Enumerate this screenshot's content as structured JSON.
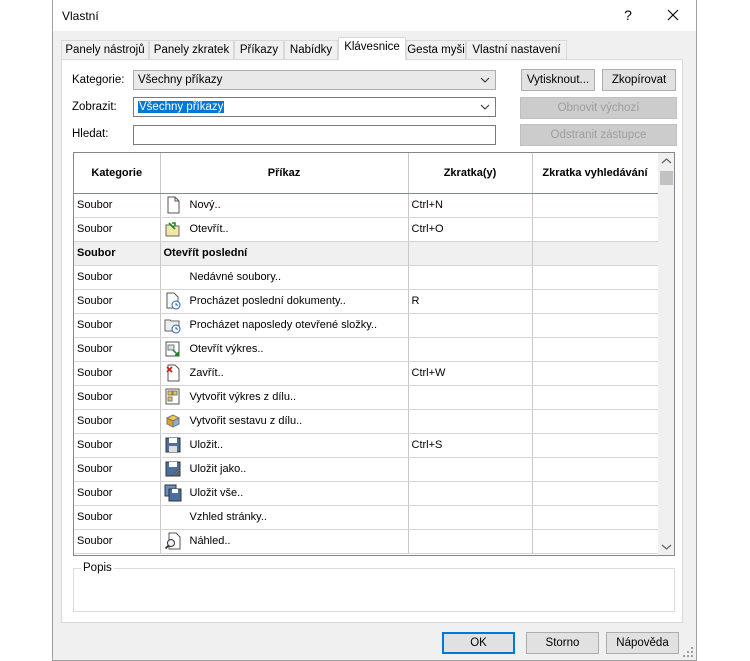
{
  "window": {
    "title": "Vlastní",
    "help_label": "?"
  },
  "tabs": [
    {
      "label": "Panely nástrojů"
    },
    {
      "label": "Panely zkratek"
    },
    {
      "label": "Příkazy"
    },
    {
      "label": "Nabídky"
    },
    {
      "label": "Klávesnice",
      "active": true
    },
    {
      "label": "Gesta myši"
    },
    {
      "label": "Vlastní  nastavení"
    }
  ],
  "filters": {
    "category_label": "Kategorie:",
    "category_value": "Všechny příkazy",
    "show_label": "Zobrazit:",
    "show_value": "Všechny příkazy",
    "search_label": "Hledat:",
    "search_value": ""
  },
  "buttons": {
    "print": "Vytisknout...",
    "copy": "Zkopírovat",
    "restore": "Obnovit výchozí",
    "remove": "Odstranit zástupce",
    "ok": "OK",
    "cancel": "Storno",
    "help": "Nápověda"
  },
  "table": {
    "headers": [
      "Kategorie",
      "Příkaz",
      "Zkratka(y)",
      "Zkratka vyhledávání"
    ],
    "rows": [
      {
        "category": "Soubor",
        "command": "Nový..",
        "shortcut": "Ctrl+N",
        "search": "",
        "icon": "new-document-icon"
      },
      {
        "category": "Soubor",
        "command": "Otevřít..",
        "shortcut": "Ctrl+O",
        "search": "",
        "icon": "open-icon"
      },
      {
        "category": "Soubor",
        "command": "Otevřít poslední",
        "shortcut": "",
        "search": "",
        "icon": "",
        "group": true
      },
      {
        "category": "Soubor",
        "command": "Nedávné soubory..",
        "shortcut": "",
        "search": "",
        "icon": ""
      },
      {
        "category": "Soubor",
        "command": "Procházet poslední dokumenty..",
        "shortcut": "R",
        "search": "",
        "icon": "recent-documents-icon"
      },
      {
        "category": "Soubor",
        "command": "Procházet naposledy otevřené složky..",
        "shortcut": "",
        "search": "",
        "icon": "recent-folders-icon"
      },
      {
        "category": "Soubor",
        "command": "Otevřít výkres..",
        "shortcut": "",
        "search": "",
        "icon": "open-drawing-icon"
      },
      {
        "category": "Soubor",
        "command": "Zavřít..",
        "shortcut": "Ctrl+W",
        "search": "",
        "icon": "close-document-icon"
      },
      {
        "category": "Soubor",
        "command": "Vytvořit výkres z dílu..",
        "shortcut": "",
        "search": "",
        "icon": "make-drawing-icon"
      },
      {
        "category": "Soubor",
        "command": "Vytvořit sestavu z dílu..",
        "shortcut": "",
        "search": "",
        "icon": "make-assembly-icon"
      },
      {
        "category": "Soubor",
        "command": "Uložit..",
        "shortcut": "Ctrl+S",
        "search": "",
        "icon": "save-icon"
      },
      {
        "category": "Soubor",
        "command": "Uložit jako..",
        "shortcut": "",
        "search": "",
        "icon": "save-as-icon"
      },
      {
        "category": "Soubor",
        "command": "Uložit vše..",
        "shortcut": "",
        "search": "",
        "icon": "save-all-icon"
      },
      {
        "category": "Soubor",
        "command": "Vzhled stránky..",
        "shortcut": "",
        "search": "",
        "icon": ""
      },
      {
        "category": "Soubor",
        "command": "Náhled..",
        "shortcut": "",
        "search": "",
        "icon": "print-preview-icon"
      }
    ]
  },
  "description": {
    "label": "Popis",
    "text": ""
  },
  "colors": {
    "accent": "#0078d7",
    "dialog_bg": "#f0f0f0",
    "group_row_bg": "#f0f0f0"
  }
}
